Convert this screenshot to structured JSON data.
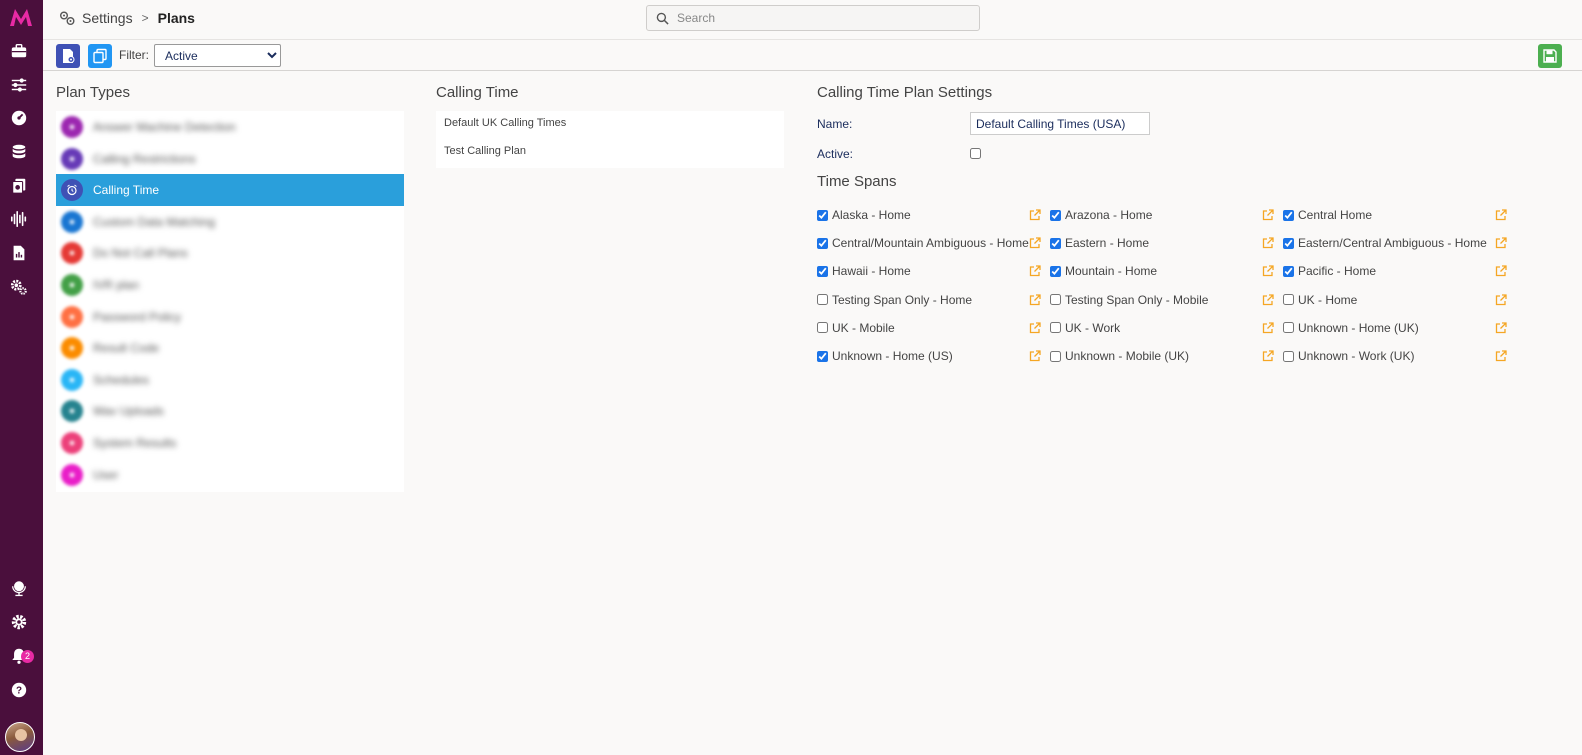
{
  "app": {
    "logo_text": "M",
    "notifications_count": "2"
  },
  "header": {
    "breadcrumb_root": "Settings",
    "breadcrumb_separator": ">",
    "breadcrumb_current": "Plans",
    "search_placeholder": "Search"
  },
  "toolbar": {
    "filter_label": "Filter:",
    "filter_value": "Active",
    "filter_options": [
      "Active"
    ]
  },
  "plan_types": {
    "title": "Plan Types",
    "items": [
      {
        "label": "Answer Machine Detection",
        "color": "#9c27b0",
        "blurred": true,
        "icon": "robot-icon"
      },
      {
        "label": "Calling Restrictions",
        "color": "#673ab7",
        "blurred": true,
        "icon": "phone-icon"
      },
      {
        "label": "Calling Time",
        "color": "#3f51b5",
        "blurred": false,
        "selected": true,
        "icon": "alarm-clock-icon"
      },
      {
        "label": "Custom Data Matching",
        "color": "#1976d2",
        "blurred": true,
        "icon": "database-icon"
      },
      {
        "label": "Do Not Call Plans",
        "color": "#e53935",
        "blurred": true,
        "icon": "block-icon"
      },
      {
        "label": "IVR plan",
        "color": "#43a047",
        "blurred": true,
        "icon": "ivr-icon"
      },
      {
        "label": "Password Policy",
        "color": "#ff7043",
        "blurred": true,
        "icon": "key-icon"
      },
      {
        "label": "Result Code",
        "color": "#fb8c00",
        "blurred": true,
        "icon": "code-icon"
      },
      {
        "label": "Schedules",
        "color": "#29b6f6",
        "blurred": true,
        "icon": "calendar-icon"
      },
      {
        "label": "Wav Uploads",
        "color": "#26838f",
        "blurred": true,
        "icon": "upload-icon"
      },
      {
        "label": "System Results",
        "color": "#ec407a",
        "blurred": true,
        "icon": "chart-icon"
      },
      {
        "label": "User",
        "color": "#e91ec8",
        "blurred": true,
        "icon": "user-icon"
      }
    ]
  },
  "calling_time": {
    "title": "Calling Time",
    "items": [
      "Default UK Calling Times",
      "Test Calling Plan"
    ]
  },
  "plan_settings": {
    "title": "Calling Time Plan Settings",
    "name_label": "Name:",
    "name_value": "Default Calling Times (USA)",
    "active_label": "Active:",
    "active": false,
    "time_spans_title": "Time Spans",
    "time_spans": [
      {
        "label": "Alaska - Home",
        "checked": true
      },
      {
        "label": "Arazona - Home",
        "checked": true
      },
      {
        "label": "Central Home",
        "checked": true
      },
      {
        "label": "Central/Mountain Ambiguous - Home",
        "checked": true
      },
      {
        "label": "Eastern - Home",
        "checked": true
      },
      {
        "label": "Eastern/Central Ambiguous - Home",
        "checked": true
      },
      {
        "label": "Hawaii - Home",
        "checked": true
      },
      {
        "label": "Mountain - Home",
        "checked": true
      },
      {
        "label": "Pacific - Home",
        "checked": true
      },
      {
        "label": "Testing Span Only - Home",
        "checked": false
      },
      {
        "label": "Testing Span Only - Mobile",
        "checked": false
      },
      {
        "label": "UK - Home",
        "checked": false
      },
      {
        "label": "UK - Mobile",
        "checked": false
      },
      {
        "label": "UK - Work",
        "checked": false
      },
      {
        "label": "Unknown - Home (UK)",
        "checked": false
      },
      {
        "label": "Unknown - Home (US)",
        "checked": true
      },
      {
        "label": "Unknown - Mobile (UK)",
        "checked": false
      },
      {
        "label": "Unknown - Work (UK)",
        "checked": false
      }
    ]
  },
  "colors": {
    "rail": "#4a0f3c",
    "accent": "#2a9fdb",
    "brand_pink": "#e82aa4",
    "save_green": "#4caf50",
    "edit_orange": "#f5a623"
  }
}
